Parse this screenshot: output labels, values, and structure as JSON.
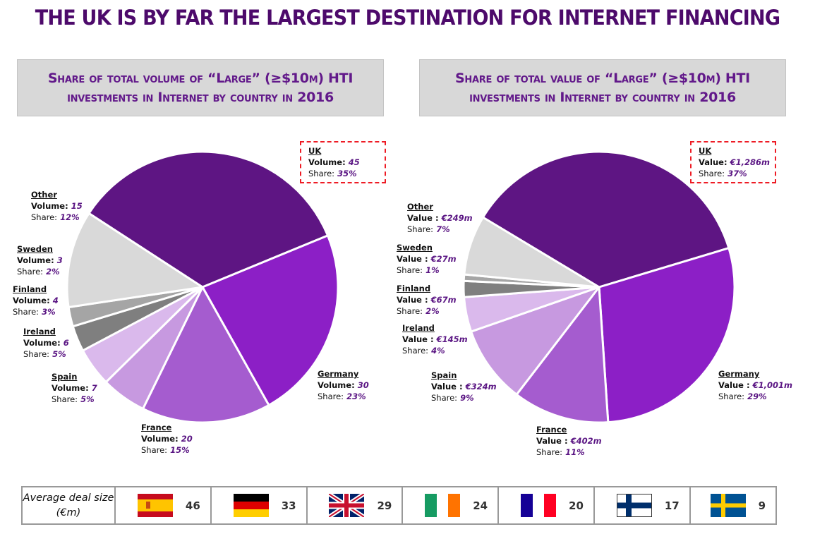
{
  "title": "THE UK IS BY FAR THE LARGEST DESTINATION FOR INTERNET FINANCING",
  "colors": {
    "title": "#4d0a6b",
    "uk": "#5e1583",
    "germany": "#8c1fc6",
    "france": "#a55ccf",
    "spain": "#c799e0",
    "ireland": "#dab9ec",
    "finland": "#7f7f7f",
    "sweden": "#a5a5a5",
    "other": "#d9d9d9",
    "callout": "#ee1c25"
  },
  "chart_data": [
    {
      "type": "pie",
      "title": "Share of total volume of “Large” (≥$10m) HTI investments in Internet by country in 2016",
      "value_label": "Volume:",
      "share_label": "Share:",
      "slices": [
        {
          "key": "uk",
          "name": "UK",
          "value": 45,
          "value_text": "45",
          "share": "35%",
          "highlighted": true
        },
        {
          "key": "germany",
          "name": "Germany",
          "value": 30,
          "value_text": "30",
          "share": "23%"
        },
        {
          "key": "france",
          "name": "France",
          "value": 20,
          "value_text": "20",
          "share": "15%"
        },
        {
          "key": "spain",
          "name": "Spain",
          "value": 7,
          "value_text": "7",
          "share": "5%"
        },
        {
          "key": "ireland",
          "name": "Ireland",
          "value": 6,
          "value_text": "6",
          "share": "5%"
        },
        {
          "key": "finland",
          "name": "Finland",
          "value": 4,
          "value_text": "4",
          "share": "3%"
        },
        {
          "key": "sweden",
          "name": "Sweden",
          "value": 3,
          "value_text": "3",
          "share": "2%"
        },
        {
          "key": "other",
          "name": "Other",
          "value": 15,
          "value_text": "15",
          "share": "12%"
        }
      ]
    },
    {
      "type": "pie",
      "title": "Share of total value of “Large” (≥$10m) HTI investments in Internet by country in 2016",
      "value_label": "Value :",
      "share_label": "Share:",
      "slices": [
        {
          "key": "uk",
          "name": "UK",
          "value": 1286,
          "value_text": "€1,286m",
          "share": "37%",
          "highlighted": true,
          "value_label": "Value:"
        },
        {
          "key": "germany",
          "name": "Germany",
          "value": 1001,
          "value_text": "€1,001m",
          "share": "29%"
        },
        {
          "key": "france",
          "name": "France",
          "value": 402,
          "value_text": "€402m",
          "share": "11%"
        },
        {
          "key": "spain",
          "name": "Spain",
          "value": 324,
          "value_text": "€324m",
          "share": "9%"
        },
        {
          "key": "ireland",
          "name": "Ireland",
          "value": 145,
          "value_text": "€145m",
          "share": "4%"
        },
        {
          "key": "finland",
          "name": "Finland",
          "value": 67,
          "value_text": "€67m",
          "share": "2%"
        },
        {
          "key": "sweden",
          "name": "Sweden",
          "value": 27,
          "value_text": "€27m",
          "share": "1%"
        },
        {
          "key": "other",
          "name": "Other",
          "value": 249,
          "value_text": "€249m",
          "share": "7%"
        }
      ]
    }
  ],
  "deal_table": {
    "label": "Average deal size (€m)",
    "entries": [
      {
        "country": "Spain",
        "flag": "spain-flag-icon",
        "value": "46"
      },
      {
        "country": "Germany",
        "flag": "germany-flag-icon",
        "value": "33"
      },
      {
        "country": "UK",
        "flag": "uk-flag-icon",
        "value": "29"
      },
      {
        "country": "Ireland",
        "flag": "ireland-flag-icon",
        "value": "24"
      },
      {
        "country": "France",
        "flag": "france-flag-icon",
        "value": "20"
      },
      {
        "country": "Finland",
        "flag": "finland-flag-icon",
        "value": "17"
      },
      {
        "country": "Sweden",
        "flag": "sweden-flag-icon",
        "value": "9"
      }
    ]
  }
}
